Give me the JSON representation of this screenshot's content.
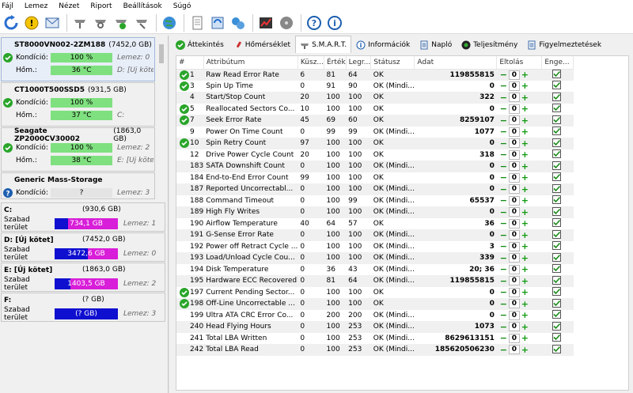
{
  "menu": [
    "Fájl",
    "Lemez",
    "Nézet",
    "Riport",
    "Beállítások",
    "Súgó"
  ],
  "disks": [
    {
      "name": "ST8000VN002-2ZM188",
      "size": "(7452,0 GB)",
      "condition_label": "Kondíció:",
      "condition": "100 %",
      "temp_label": "Hőm.:",
      "temp": "36 °C",
      "extra1": "Lemez: 0",
      "extra2": "D: [Új köte"
    },
    {
      "name": "CT1000T500SSD5",
      "size": "(931,5 GB)",
      "condition_label": "Kondíció:",
      "condition": "100 %",
      "temp_label": "Hőm.:",
      "temp": "37 °C",
      "extra1": "",
      "extra2": "C:"
    },
    {
      "name": "Seagate ZP2000CV30002",
      "size": "(1863,0 GB)",
      "condition_label": "Kondíció:",
      "condition": "100 %",
      "temp_label": "Hőm.:",
      "temp": "38 °C",
      "extra1": "Lemez: 2",
      "extra2": "E: [Új köte"
    },
    {
      "name": "Generic Mass-Storage",
      "size": "",
      "condition_label": "Kondíció:",
      "condition": "?",
      "extra1": "Lemez: 3"
    }
  ],
  "partitions": [
    {
      "name": "C:",
      "size": "(930,6 GB)",
      "free_label": "Szabad terület",
      "free": "734,1 GB",
      "fill": 0.79,
      "disk": "Lemez: 1"
    },
    {
      "name": "D: [Új kötet]",
      "size": "(7452,0 GB)",
      "free_label": "Szabad terület",
      "free": "3472,6 GB",
      "fill": 0.47,
      "disk": "Lemez: 0"
    },
    {
      "name": "E: [Új kötet]",
      "size": "(1863,0 GB)",
      "free_label": "Szabad terület",
      "free": "1403,5 GB",
      "fill": 0.75,
      "disk": "Lemez: 2"
    },
    {
      "name": "F:",
      "size": "(? GB)",
      "free_label": "Szabad terület",
      "free": "(? GB)",
      "fill": 0,
      "disk": "Lemez: 3"
    }
  ],
  "tabs": [
    "Áttekintés",
    "Hőmérséklet",
    "S.M.A.R.T.",
    "Információk",
    "Napló",
    "Teljesítmény",
    "Figyelmeztetések"
  ],
  "active_tab": 2,
  "columns": [
    "#",
    "Attribútum",
    "Küsz...",
    "Érték",
    "Legr...",
    "Státusz",
    "Adat",
    "Eltolás",
    "Enge..."
  ],
  "rows": [
    {
      "id": "1",
      "ok": true,
      "attr": "Raw Read Error Rate",
      "k": "6",
      "e": "81",
      "l": "64",
      "st": "OK",
      "data": "119855815"
    },
    {
      "id": "3",
      "ok": true,
      "attr": "Spin Up Time",
      "k": "0",
      "e": "91",
      "l": "90",
      "st": "OK (Mindi...",
      "data": "0"
    },
    {
      "id": "4",
      "ok": false,
      "attr": "Start/Stop Count",
      "k": "20",
      "e": "100",
      "l": "100",
      "st": "OK",
      "data": "322"
    },
    {
      "id": "5",
      "ok": true,
      "attr": "Reallocated Sectors Co...",
      "k": "10",
      "e": "100",
      "l": "100",
      "st": "OK",
      "data": "0"
    },
    {
      "id": "7",
      "ok": true,
      "attr": "Seek Error Rate",
      "k": "45",
      "e": "69",
      "l": "60",
      "st": "OK",
      "data": "8259107"
    },
    {
      "id": "9",
      "ok": false,
      "attr": "Power On Time Count",
      "k": "0",
      "e": "99",
      "l": "99",
      "st": "OK (Mindi...",
      "data": "1077"
    },
    {
      "id": "10",
      "ok": true,
      "attr": "Spin Retry Count",
      "k": "97",
      "e": "100",
      "l": "100",
      "st": "OK",
      "data": "0"
    },
    {
      "id": "12",
      "ok": false,
      "attr": "Drive Power Cycle Count",
      "k": "20",
      "e": "100",
      "l": "100",
      "st": "OK",
      "data": "318"
    },
    {
      "id": "183",
      "ok": false,
      "attr": "SATA Downshift Count",
      "k": "0",
      "e": "100",
      "l": "100",
      "st": "OK (Mindi...",
      "data": "0"
    },
    {
      "id": "184",
      "ok": false,
      "attr": "End-to-End Error Count",
      "k": "99",
      "e": "100",
      "l": "100",
      "st": "OK",
      "data": "0"
    },
    {
      "id": "187",
      "ok": false,
      "attr": "Reported Uncorrectabl...",
      "k": "0",
      "e": "100",
      "l": "100",
      "st": "OK (Mindi...",
      "data": "0"
    },
    {
      "id": "188",
      "ok": false,
      "attr": "Command Timeout",
      "k": "0",
      "e": "100",
      "l": "99",
      "st": "OK (Mindi...",
      "data": "65537"
    },
    {
      "id": "189",
      "ok": false,
      "attr": "High Fly Writes",
      "k": "0",
      "e": "100",
      "l": "100",
      "st": "OK (Mindi...",
      "data": "0"
    },
    {
      "id": "190",
      "ok": false,
      "attr": "Airflow Temperature",
      "k": "40",
      "e": "64",
      "l": "57",
      "st": "OK",
      "data": "36"
    },
    {
      "id": "191",
      "ok": false,
      "attr": "G-Sense Error Rate",
      "k": "0",
      "e": "100",
      "l": "100",
      "st": "OK (Mindi...",
      "data": "0"
    },
    {
      "id": "192",
      "ok": false,
      "attr": "Power off Retract Cycle ...",
      "k": "0",
      "e": "100",
      "l": "100",
      "st": "OK (Mindi...",
      "data": "3"
    },
    {
      "id": "193",
      "ok": false,
      "attr": "Load/Unload Cycle Cou...",
      "k": "0",
      "e": "100",
      "l": "100",
      "st": "OK (Mindi...",
      "data": "339"
    },
    {
      "id": "194",
      "ok": false,
      "attr": "Disk Temperature",
      "k": "0",
      "e": "36",
      "l": "43",
      "st": "OK (Mindi...",
      "data": "20; 36"
    },
    {
      "id": "195",
      "ok": false,
      "attr": "Hardware ECC Recovered",
      "k": "0",
      "e": "81",
      "l": "64",
      "st": "OK (Mindi...",
      "data": "119855815"
    },
    {
      "id": "197",
      "ok": true,
      "attr": "Current Pending Sector...",
      "k": "0",
      "e": "100",
      "l": "100",
      "st": "OK",
      "data": "0"
    },
    {
      "id": "198",
      "ok": true,
      "attr": "Off-Line Uncorrectable ...",
      "k": "0",
      "e": "100",
      "l": "100",
      "st": "OK",
      "data": "0"
    },
    {
      "id": "199",
      "ok": false,
      "attr": "Ultra ATA CRC Error Co...",
      "k": "0",
      "e": "200",
      "l": "200",
      "st": "OK (Mindi...",
      "data": "0"
    },
    {
      "id": "240",
      "ok": false,
      "attr": "Head Flying Hours",
      "k": "0",
      "e": "100",
      "l": "253",
      "st": "OK (Mindi...",
      "data": "1073"
    },
    {
      "id": "241",
      "ok": false,
      "attr": "Total LBA Written",
      "k": "0",
      "e": "100",
      "l": "253",
      "st": "OK (Mindi...",
      "data": "8629613151"
    },
    {
      "id": "242",
      "ok": false,
      "attr": "Total LBA Read",
      "k": "0",
      "e": "100",
      "l": "253",
      "st": "OK (Mindi...",
      "data": "185620506230"
    }
  ],
  "offset_value": "0",
  "colors": {
    "ok_green": "#2aa52a",
    "bar_blue": "#0f0fd0",
    "bar_magenta": "#d81ed8",
    "cond_green": "#7fe07f"
  }
}
